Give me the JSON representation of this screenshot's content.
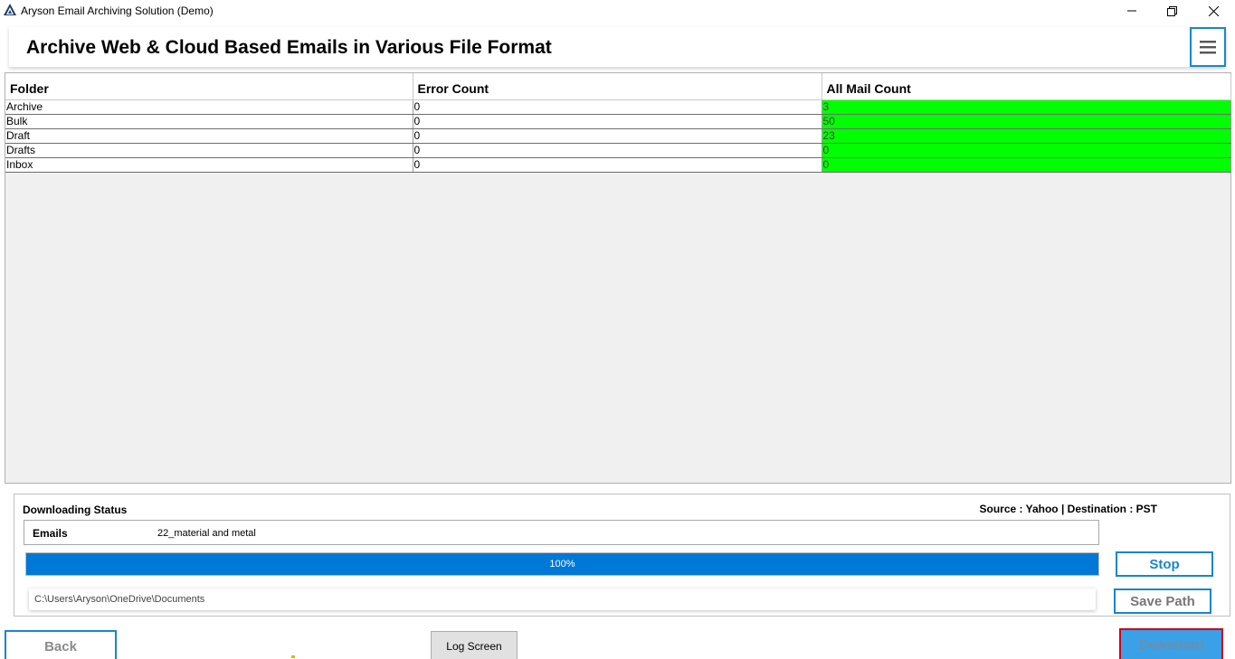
{
  "window": {
    "title": "Aryson Email Archiving Solution (Demo)"
  },
  "header": {
    "title": "Archive Web & Cloud Based Emails in Various File Format",
    "menu_icon": "hamburger-menu-icon"
  },
  "table": {
    "columns": [
      "Folder",
      "Error Count",
      "All Mail Count"
    ],
    "rows": [
      {
        "folder": "Archive",
        "error_count": "0",
        "all_mail_count": "3"
      },
      {
        "folder": "Bulk",
        "error_count": "0",
        "all_mail_count": "50"
      },
      {
        "folder": "Draft",
        "error_count": "0",
        "all_mail_count": "23"
      },
      {
        "folder": "Drafts",
        "error_count": "0",
        "all_mail_count": "0"
      },
      {
        "folder": "Inbox",
        "error_count": "0",
        "all_mail_count": "0"
      }
    ],
    "count_cell_color": "#00ff00"
  },
  "status": {
    "label": "Downloading Status",
    "source_dest": "Source : Yahoo | Destination : PST",
    "emails_label": "Emails",
    "emails_value": "22_material and metal",
    "progress_percent": 100,
    "progress_text": "100%",
    "save_path": "C:\\Users\\Aryson\\OneDrive\\Documents",
    "stop_label": "Stop",
    "save_path_label": "Save Path"
  },
  "footer": {
    "back_label": "Back",
    "log_label": "Log Screen",
    "download_label": "Download"
  },
  "colors": {
    "accent": "#1a86c7",
    "progress": "#0078d7",
    "download_bg": "#3aa0e8",
    "download_border": "#d0021b"
  }
}
